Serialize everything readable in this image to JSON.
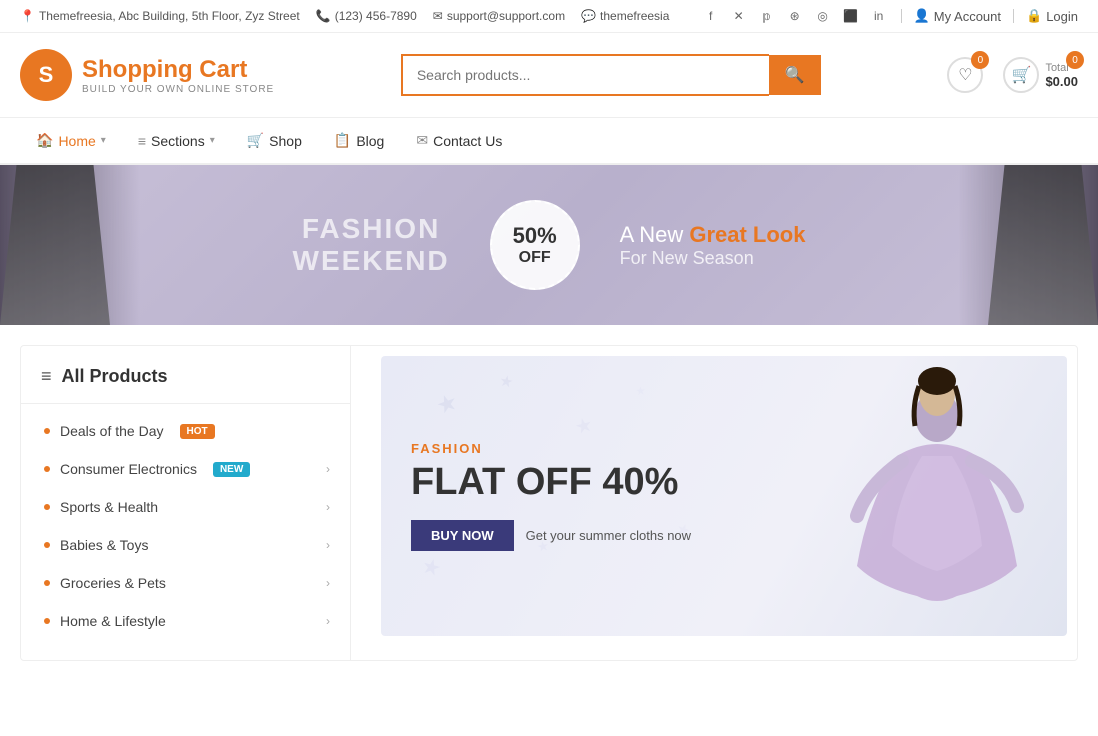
{
  "topbar": {
    "address": "Themefreesia, Abc Building, 5th Floor, Zyz Street",
    "phone": "(123) 456-7890",
    "email": "support@support.com",
    "skype": "themefreesia",
    "my_account": "My Account",
    "login": "Login"
  },
  "social": [
    "f",
    "𝕏",
    "𝕡",
    "⊕",
    "📷",
    "🎬",
    "in"
  ],
  "logo": {
    "icon": "S",
    "title": "Shopping Cart",
    "subtitle": "BUILD YOUR OWN ONLINE STORE"
  },
  "search": {
    "placeholder": "Search products...",
    "button_label": "🔍"
  },
  "wishlist": {
    "count": "0"
  },
  "cart": {
    "count": "0",
    "total_label": "Total",
    "total_value": "$0.00"
  },
  "nav": {
    "items": [
      {
        "label": "Home",
        "icon": "🏠",
        "has_arrow": true
      },
      {
        "label": "Sections",
        "icon": "≡",
        "has_arrow": true
      },
      {
        "label": "Shop",
        "icon": "🛒",
        "has_arrow": false
      },
      {
        "label": "Blog",
        "icon": "📋",
        "has_arrow": false
      },
      {
        "label": "Contact Us",
        "icon": "✉",
        "has_arrow": false
      }
    ]
  },
  "banner": {
    "left_text1": "FASHION",
    "left_text2": "WEEKEND",
    "circle_percent": "50%",
    "circle_off": "OFF",
    "right_line1a": "A New ",
    "right_line1b": "Great Look",
    "right_line2": "For New Season"
  },
  "sidebar": {
    "header": "All Products",
    "items": [
      {
        "label": "Deals of the Day",
        "badge": "HOT",
        "badge_type": "hot",
        "has_arrow": false
      },
      {
        "label": "Consumer Electronics",
        "badge": "NEW",
        "badge_type": "new",
        "has_arrow": true
      },
      {
        "label": "Sports & Health",
        "badge": "",
        "badge_type": "",
        "has_arrow": true
      },
      {
        "label": "Babies & Toys",
        "badge": "",
        "badge_type": "",
        "has_arrow": true
      },
      {
        "label": "Groceries & Pets",
        "badge": "",
        "badge_type": "",
        "has_arrow": true
      },
      {
        "label": "Home & Lifestyle",
        "badge": "",
        "badge_type": "",
        "has_arrow": true
      }
    ]
  },
  "promo": {
    "fashion_label": "FASHION",
    "flat_label": "FLAT OFF 40%",
    "cta_button": "BUY NOW",
    "cta_text": "Get your summer cloths now"
  }
}
